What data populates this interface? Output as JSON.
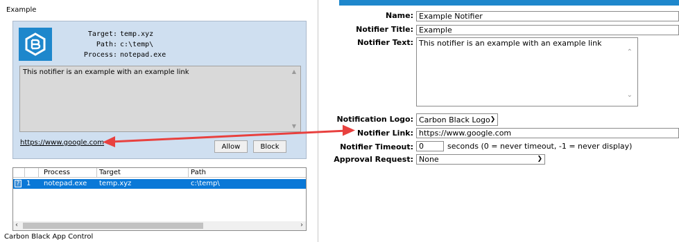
{
  "window": {
    "title": "Example",
    "app_name": "Carbon Black App Control"
  },
  "notifier_preview": {
    "logo_icon": "carbon-black-logo-icon",
    "info": [
      {
        "key": "Target:",
        "value": "temp.xyz"
      },
      {
        "key": "Path:",
        "value": "c:\\temp\\"
      },
      {
        "key": "Process:",
        "value": "notepad.exe"
      }
    ],
    "text": "This notifier is an example with an example link",
    "link": "https://www.google.com",
    "allow_label": "Allow",
    "block_label": "Block"
  },
  "table": {
    "columns": [
      "Process",
      "Target",
      "Path"
    ],
    "rows": [
      {
        "num": "1",
        "process": "notepad.exe",
        "target": "temp.xyz",
        "path": "c:\\temp\\"
      }
    ],
    "row_icon_glyph": "?"
  },
  "form": {
    "name_label": "Name:",
    "name_value": "Example Notifier",
    "title_label": "Notifier Title:",
    "title_value": "Example",
    "text_label": "Notifier Text:",
    "text_value": "This notifier is an example with an example link",
    "logo_label": "Notification Logo:",
    "logo_value": "Carbon Black Logo",
    "link_label": "Notifier Link:",
    "link_value": "https://www.google.com",
    "timeout_label": "Notifier Timeout:",
    "timeout_value": "0",
    "timeout_hint": "seconds (0 = never timeout, -1 = never display)",
    "approval_label": "Approval Request:",
    "approval_value": "None"
  },
  "colors": {
    "brand_blue": "#1e87cc",
    "panel_bg": "#cfdff0",
    "selection": "#0a78d7",
    "arrow_red": "#e8413f"
  }
}
